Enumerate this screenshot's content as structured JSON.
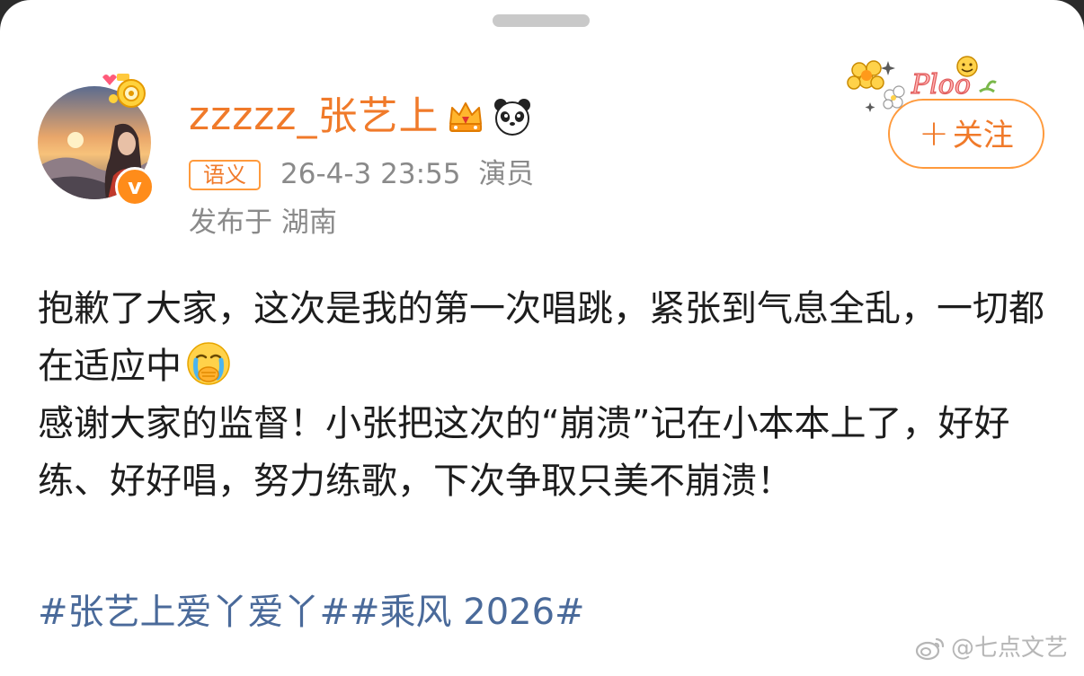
{
  "post": {
    "username": "zzzzz_张艺上",
    "tag": "语义",
    "timestamp": "26-4-3 23:55",
    "role": "演员",
    "location": "发布于 湖南",
    "follow_label": "关注",
    "follow_plus": "+",
    "lines": [
      "抱歉了大家，这次是我的第一次唱跳，紧张到气息全乱，一切都在适应中",
      "感谢大家的监督！小张把这次的“崩溃”记在小本本上了，好好练、好好唱，努力练歌，下次争取只美不崩溃！"
    ],
    "hashtags": "#张艺上爱丫爱丫##乘风 2026#",
    "verified_mark": "v"
  },
  "watermark": {
    "text": "@七点文艺"
  },
  "decoration": {
    "sticker_text": "Ploo"
  },
  "colors": {
    "accent": "#f07a2a",
    "link": "#4a6a9a",
    "meta": "#8a8a8a"
  },
  "icons": {
    "crown": "crown-icon",
    "panda": "panda-icon",
    "emoji": "crying-face-emoji-icon",
    "weibo": "weibo-logo-icon"
  }
}
